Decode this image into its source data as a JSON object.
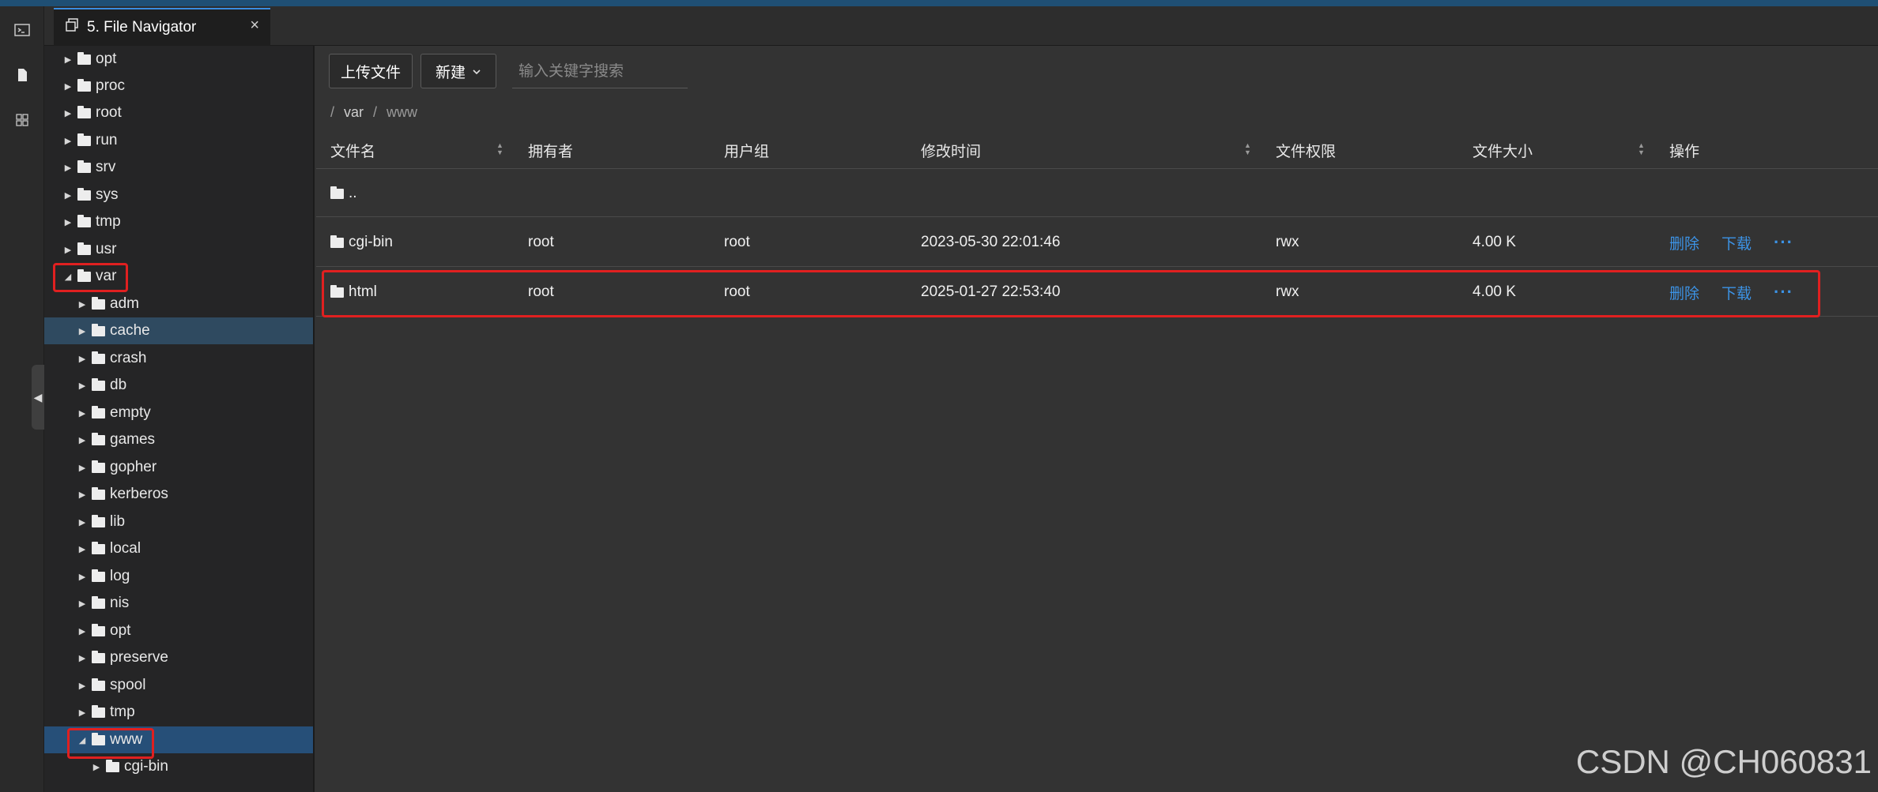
{
  "tab": {
    "title": "5. File Navigator",
    "close": "×"
  },
  "tree": {
    "top_items": [
      "opt",
      "proc",
      "root",
      "run",
      "srv",
      "sys",
      "tmp",
      "usr"
    ],
    "expanded": "var",
    "var_children": [
      "adm",
      "cache",
      "crash",
      "db",
      "empty",
      "games",
      "gopher",
      "kerberos",
      "lib",
      "local",
      "log",
      "nis",
      "opt",
      "preserve",
      "spool",
      "tmp",
      "www"
    ],
    "www_children": [
      "cgi-bin"
    ]
  },
  "toolbar": {
    "upload_label": "上传文件",
    "new_label": "新建",
    "search_placeholder": "输入关键字搜索"
  },
  "breadcrumb": {
    "sep1": "/",
    "part1": "var",
    "sep2": "/",
    "part2": "www"
  },
  "table": {
    "headers": [
      "文件名",
      "拥有者",
      "用户组",
      "修改时间",
      "文件权限",
      "文件大小",
      "操作"
    ],
    "parent_row": "..",
    "rows": [
      {
        "name": "cgi-bin",
        "owner": "root",
        "group": "root",
        "mtime": "2023-05-30 22:01:46",
        "perm": "rwx",
        "size": "4.00 K"
      },
      {
        "name": "html",
        "owner": "root",
        "group": "root",
        "mtime": "2025-01-27 22:53:40",
        "perm": "rwx",
        "size": "4.00 K"
      }
    ],
    "actions": {
      "delete": "删除",
      "download": "下载",
      "more": "···"
    }
  },
  "watermark": "CSDN @CH060831",
  "colors": {
    "accent": "#3c93e6",
    "highlight": "#e02020",
    "selected": "#264f78"
  }
}
